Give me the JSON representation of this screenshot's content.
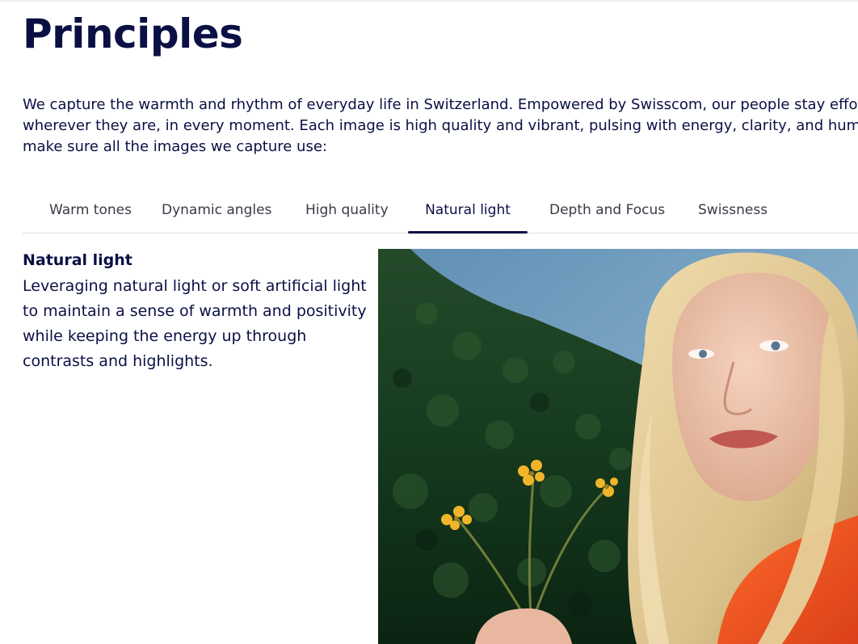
{
  "page": {
    "title": "Principles",
    "intro_lines": [
      "We capture the warmth and rhythm of everyday life in Switzerland. Empowered by Swisscom, our people stay effort",
      "wherever they are, in every moment. Each image is high quality and vibrant, pulsing with energy, clarity, and human",
      "make sure all the images we capture use:"
    ]
  },
  "tabs": [
    {
      "label": "Warm tones"
    },
    {
      "label": "Dynamic angles"
    },
    {
      "label": "High quality"
    },
    {
      "label": "Natural light",
      "active": true
    },
    {
      "label": "Depth and Focus"
    },
    {
      "label": "Swissness"
    }
  ],
  "panel": {
    "heading": "Natural light",
    "text_lines": [
      "Leveraging natural light or soft artificial light",
      "to maintain a sense of warmth and positivity",
      "while keeping the energy up through",
      "contrasts and highlights."
    ]
  },
  "colors": {
    "text": "#0b1044",
    "tab_text": "#3a3a46",
    "divider": "#dedede"
  }
}
